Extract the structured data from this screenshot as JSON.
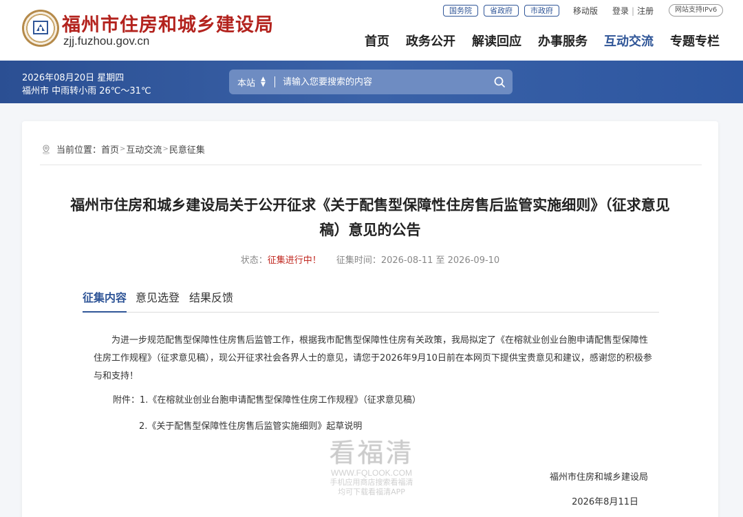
{
  "header": {
    "site_name": "福州市住房和城乡建设局",
    "site_domain": "zjj.fuzhou.gov.cn",
    "gov_links": [
      "国务院",
      "省政府",
      "市政府"
    ],
    "mobile_label": "移动版",
    "login_label": "登录",
    "register_label": "注册",
    "ipv6_label": "网站支持IPv6",
    "nav": [
      "首页",
      "政务公开",
      "解读回应",
      "办事服务",
      "互动交流",
      "专题专栏"
    ],
    "nav_active_index": 4
  },
  "banner": {
    "date": "2026年08月20日 星期四",
    "weather": "福州市 中雨转小雨 26℃～31℃",
    "search_scope": "本站",
    "search_placeholder": "请输入您要搜索的内容"
  },
  "breadcrumb": {
    "prefix": "当前位置：",
    "items": [
      "首页",
      "互动交流",
      "民意征集"
    ]
  },
  "article": {
    "title": "福州市住房和城乡建设局关于公开征求《关于配售型保障性住房售后监管实施细则》（征求意见稿）意见的公告",
    "status_label": "状态：",
    "status_value": "征集进行中！",
    "period_label": "征集时间：",
    "period_value": "2026-08-11 至 2026-09-10",
    "tabs": [
      "征集内容",
      "意见选登",
      "结果反馈"
    ],
    "active_tab": 0,
    "body": "为进一步规范配售型保障性住房售后监管工作，根据我市配售型保障性住房有关政策，我局拟定了《在榕就业创业台胞申请配售型保障性住房工作规程》（征求意见稿），现公开征求社会各界人士的意见，请您于2026年9月10日前在本网页下提供宝贵意见和建议，感谢您的积极参与和支持！",
    "attachments_label": "附件：",
    "attachments": [
      "1.《在榕就业创业台胞申请配售型保障性住房工作规程》（征求意见稿）",
      "2.《关于配售型保障性住房售后监管实施细则》起草说明"
    ],
    "signer": "福州市住房和城乡建设局",
    "sign_date": "2026年8月11日"
  },
  "watermark": {
    "brand": "看福清",
    "url": "WWW.FQLOOK.COM",
    "line1": "手机应用商店搜索看福清",
    "line2": "均可下载看福清APP"
  },
  "colors": {
    "brand_red": "#b3231e",
    "primary_blue": "#2f5597",
    "banner_blue": "#3a62a8",
    "status_red": "#c0261e"
  }
}
